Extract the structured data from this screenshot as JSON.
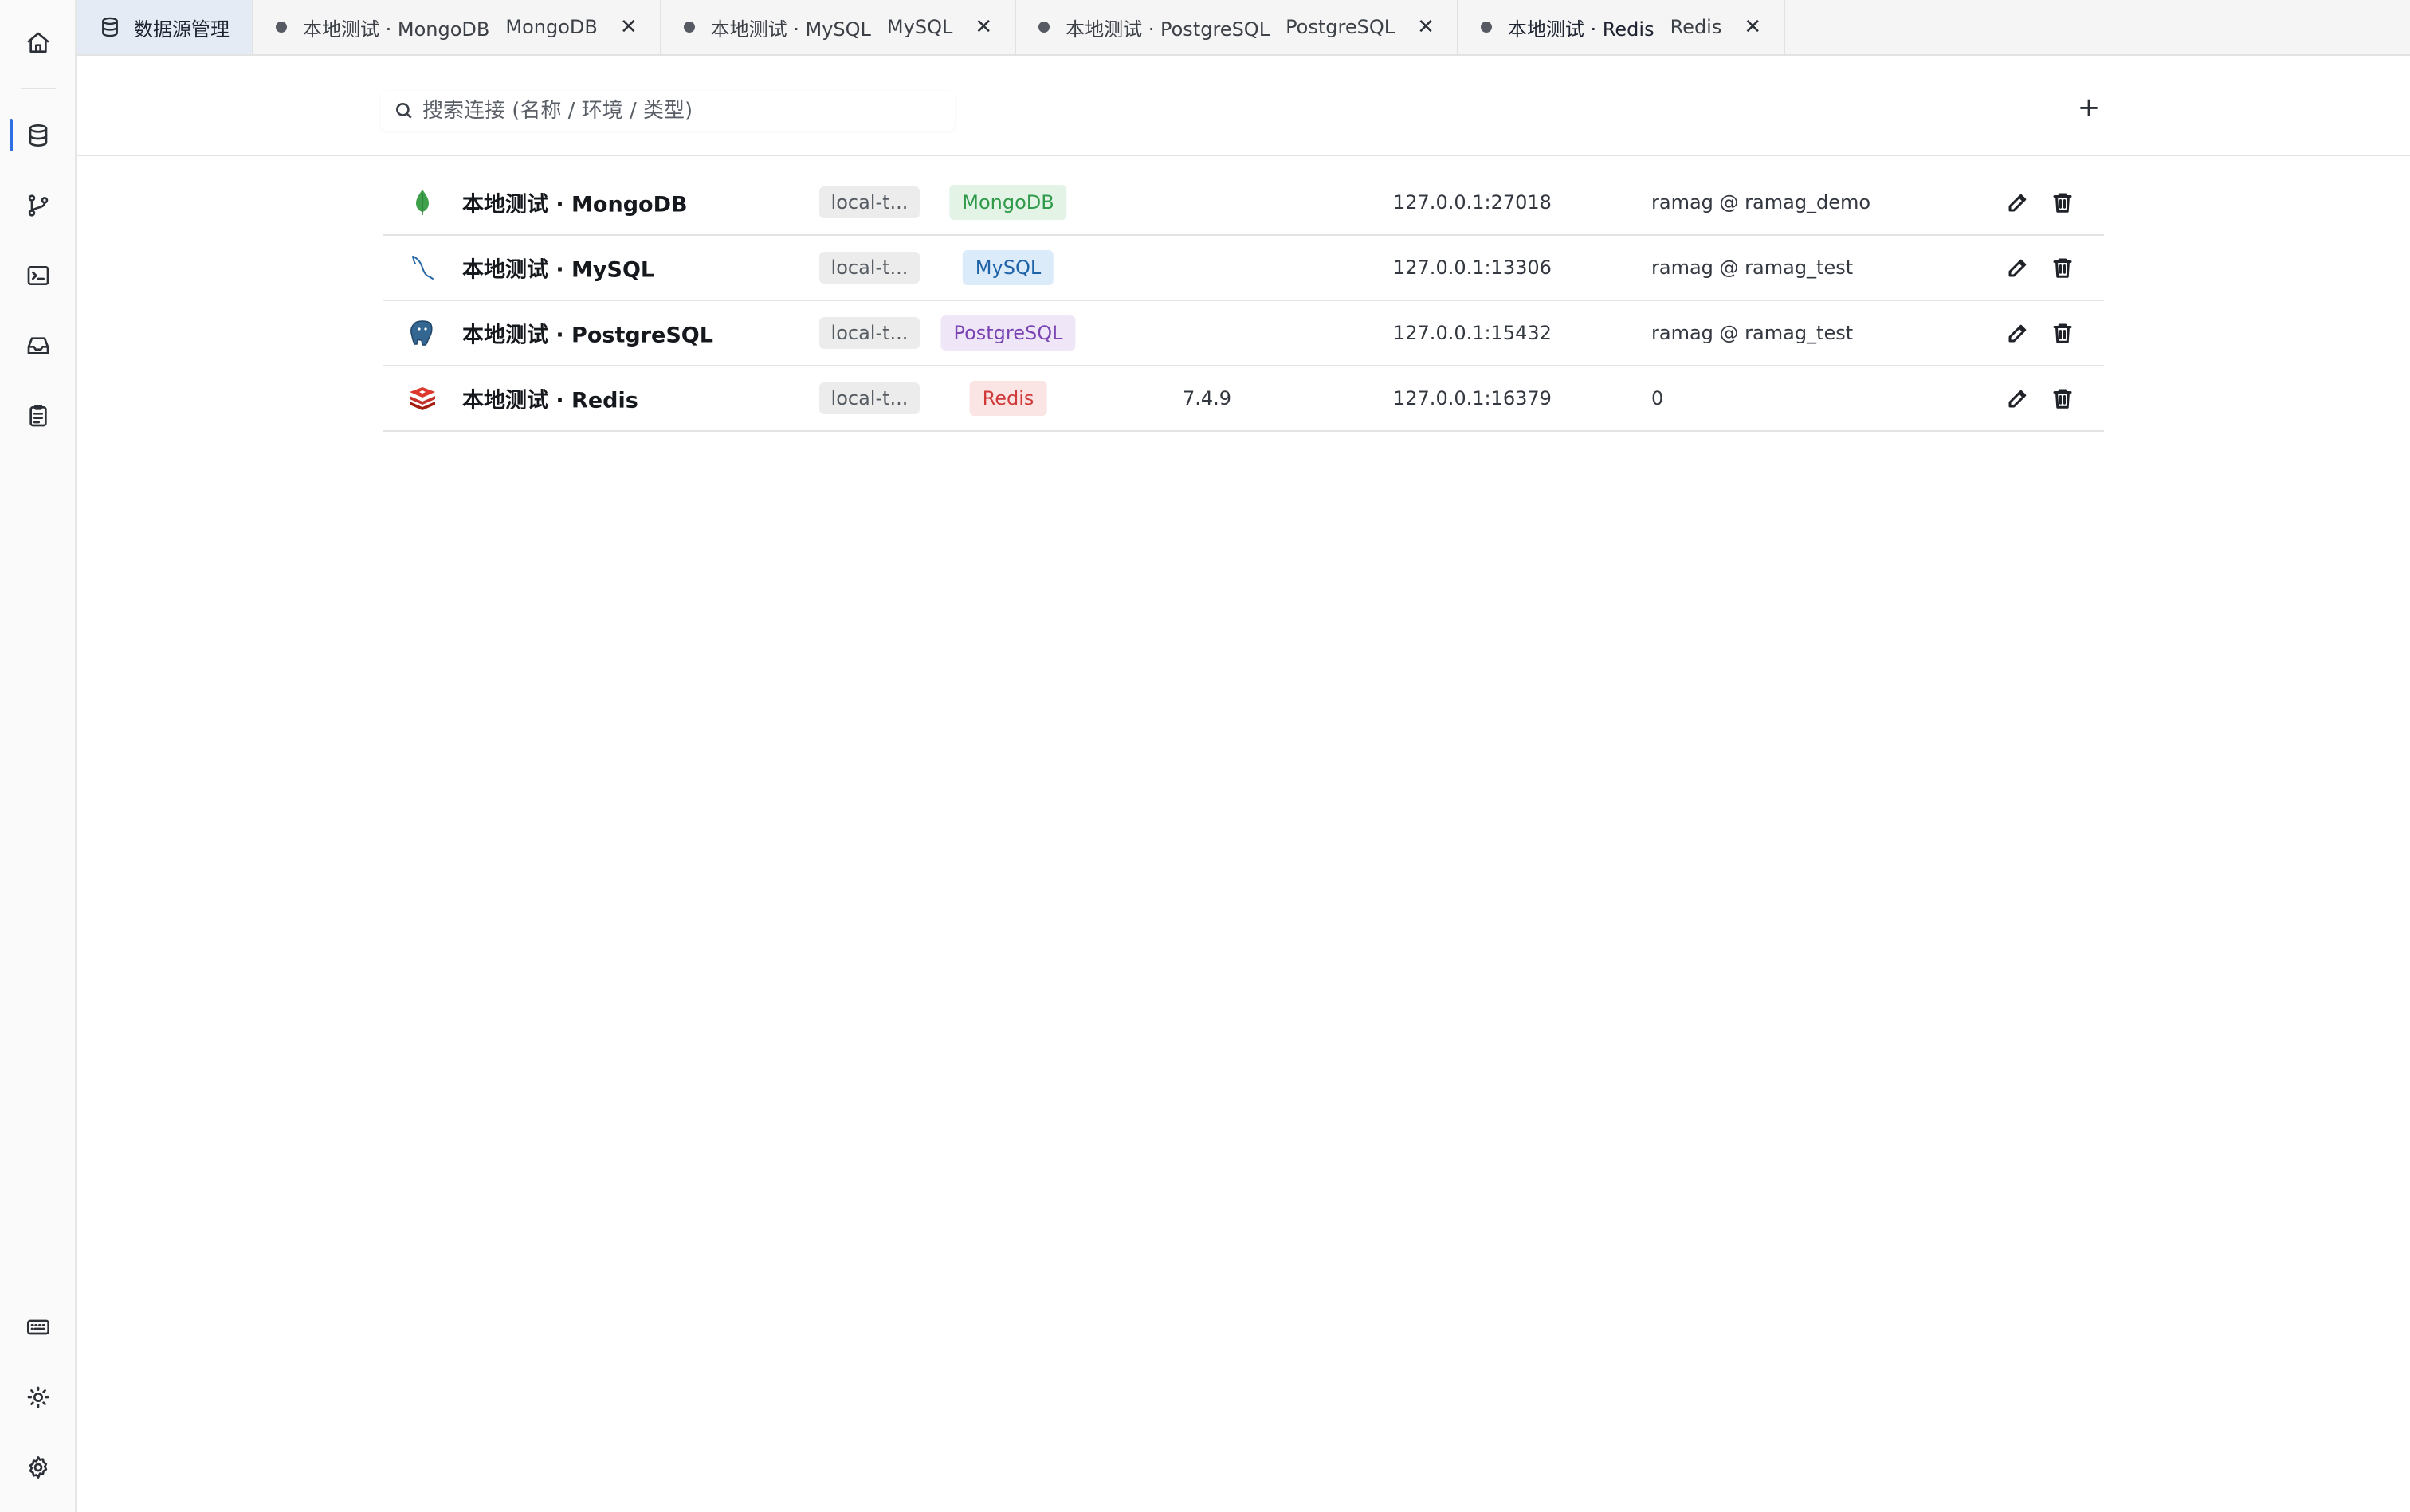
{
  "tabs": [
    {
      "label": "数据源管理",
      "type": "",
      "active": true
    },
    {
      "label": "本地测试 · MongoDB",
      "type": "MongoDB"
    },
    {
      "label": "本地测试 · MySQL",
      "type": "MySQL"
    },
    {
      "label": "本地测试 · PostgreSQL",
      "type": "PostgreSQL"
    },
    {
      "label": "本地测试 · Redis",
      "type": "Redis"
    }
  ],
  "search": {
    "placeholder": "搜索连接 (名称 / 环境 / 类型)"
  },
  "toolbar": {
    "add_label": "+"
  },
  "connections": [
    {
      "name": "本地测试 · MongoDB",
      "env": "local-t...",
      "type": "MongoDB",
      "version": "",
      "address": "127.0.0.1:27018",
      "user": "ramag @ ramag_demo",
      "icon": "mongodb-leaf-icon"
    },
    {
      "name": "本地测试 · MySQL",
      "env": "local-t...",
      "type": "MySQL",
      "version": "",
      "address": "127.0.0.1:13306",
      "user": "ramag @ ramag_test",
      "icon": "mysql-dolphin-icon"
    },
    {
      "name": "本地测试 · PostgreSQL",
      "env": "local-t...",
      "type": "PostgreSQL",
      "version": "",
      "address": "127.0.0.1:15432",
      "user": "ramag @ ramag_test",
      "icon": "postgresql-elephant-icon"
    },
    {
      "name": "本地测试 · Redis",
      "env": "local-t...",
      "type": "Redis",
      "version": "7.4.9",
      "address": "127.0.0.1:16379",
      "user": "0",
      "icon": "redis-cube-icon"
    }
  ],
  "colors": {
    "accent": "#2f6fe4",
    "mongodb_bg": "#e3f4e7",
    "mongodb_fg": "#2f9a4a",
    "mysql_bg": "#dcebfa",
    "mysql_fg": "#1e63a8",
    "postgresql_bg": "#efe6f8",
    "postgresql_fg": "#7a44b3",
    "redis_bg": "#fbe4e4",
    "redis_fg": "#d03a3a"
  }
}
